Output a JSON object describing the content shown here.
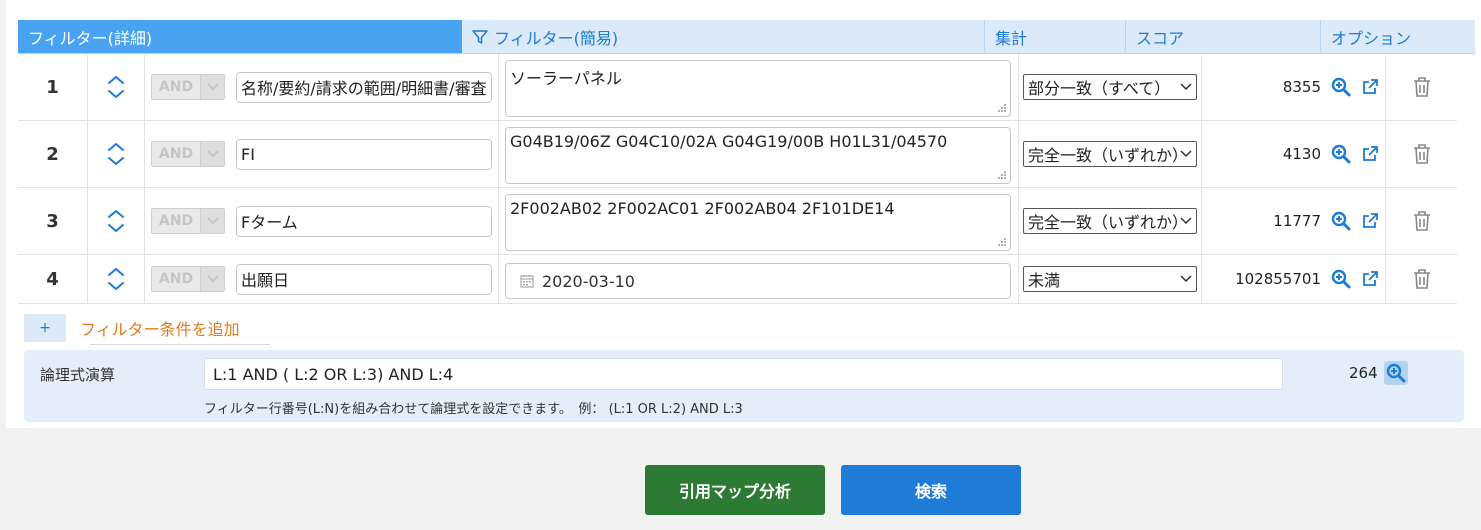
{
  "tabs": {
    "detail": "フィルター(詳細)",
    "simple": "フィルター(簡易)",
    "aggregate": "集計",
    "score": "スコア",
    "options": "オプション"
  },
  "rows": [
    {
      "num": "1",
      "op": "AND",
      "field": "名称/要約/請求の範囲/明細書/審査",
      "value": "ソーラーパネル",
      "match": "部分一致（すべて）",
      "score": "8355"
    },
    {
      "num": "2",
      "op": "AND",
      "field": "FI",
      "value": "G04B19/06Z G04C10/02A G04G19/00B H01L31/04570",
      "match": "完全一致（いずれか）",
      "score": "4130"
    },
    {
      "num": "3",
      "op": "AND",
      "field": "Fターム",
      "value": "2F002AB02 2F002AC01 2F002AB04 2F101DE14",
      "match": "完全一致（いずれか）",
      "score": "11777"
    },
    {
      "num": "4",
      "op": "AND",
      "field": "出願日",
      "value": "2020-03-10",
      "match": "未満",
      "score": "102855701"
    }
  ],
  "add_filter": {
    "plus": "+",
    "label": "フィルター条件を追加"
  },
  "logic": {
    "label": "論理式演算",
    "expression": "L:1 AND ( L:2 OR L:3) AND L:4",
    "count": "264",
    "help": "フィルター行番号(L:N)を組み合わせて論理式を設定できます。　例：  (L:1 OR L:2) AND L:3"
  },
  "buttons": {
    "citation": "引用マップ分析",
    "search": "検索"
  },
  "colors": {
    "accent": "#1e7bd6",
    "tab_active": "#4aa2f2",
    "tab_bg": "#dbe9f8",
    "add_label": "#e07a1e",
    "citation_btn": "#2d7a34"
  }
}
